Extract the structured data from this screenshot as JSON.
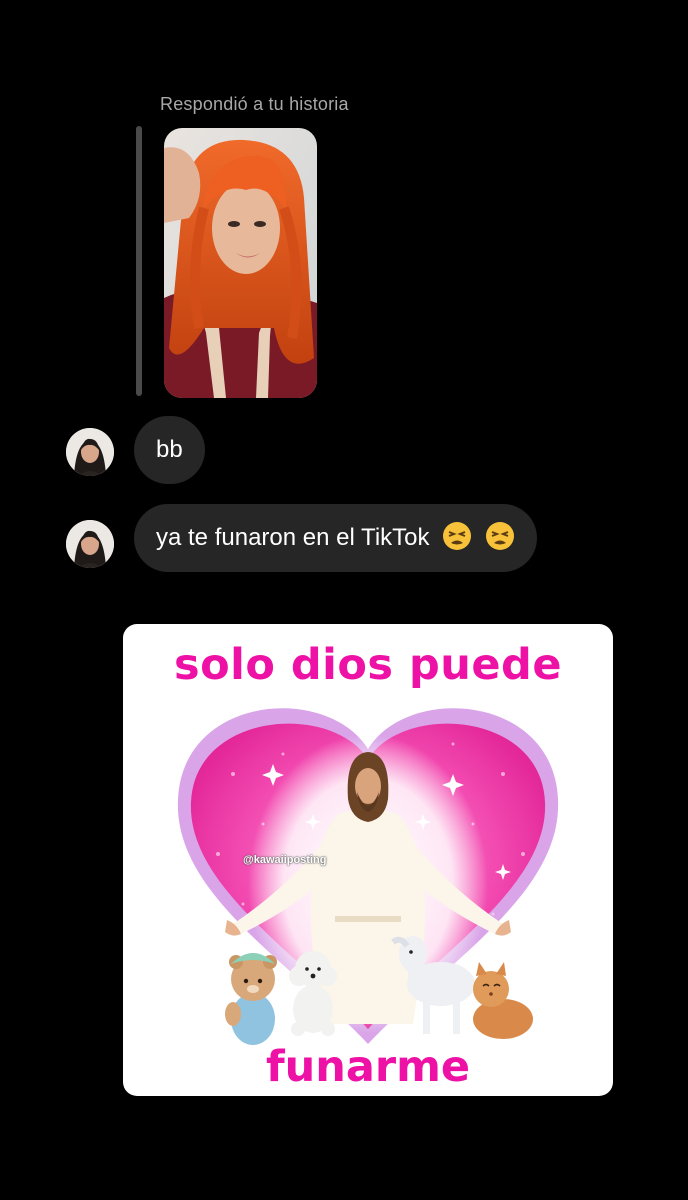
{
  "thread": {
    "reply_label": "Respondió a tu historia",
    "messages": [
      {
        "text": "bb",
        "emoji": ""
      },
      {
        "text": "ya te funaron en el TikTok",
        "emoji": "tired-face-emoji x2"
      }
    ]
  },
  "meme": {
    "top_text": "solo dios puede",
    "bottom_text": "funarme",
    "watermark": "@kawaiiposting",
    "accent_color": "#ee11a6"
  },
  "colors": {
    "background": "#000000",
    "bubble": "#262626",
    "label": "#a8a8a8"
  }
}
